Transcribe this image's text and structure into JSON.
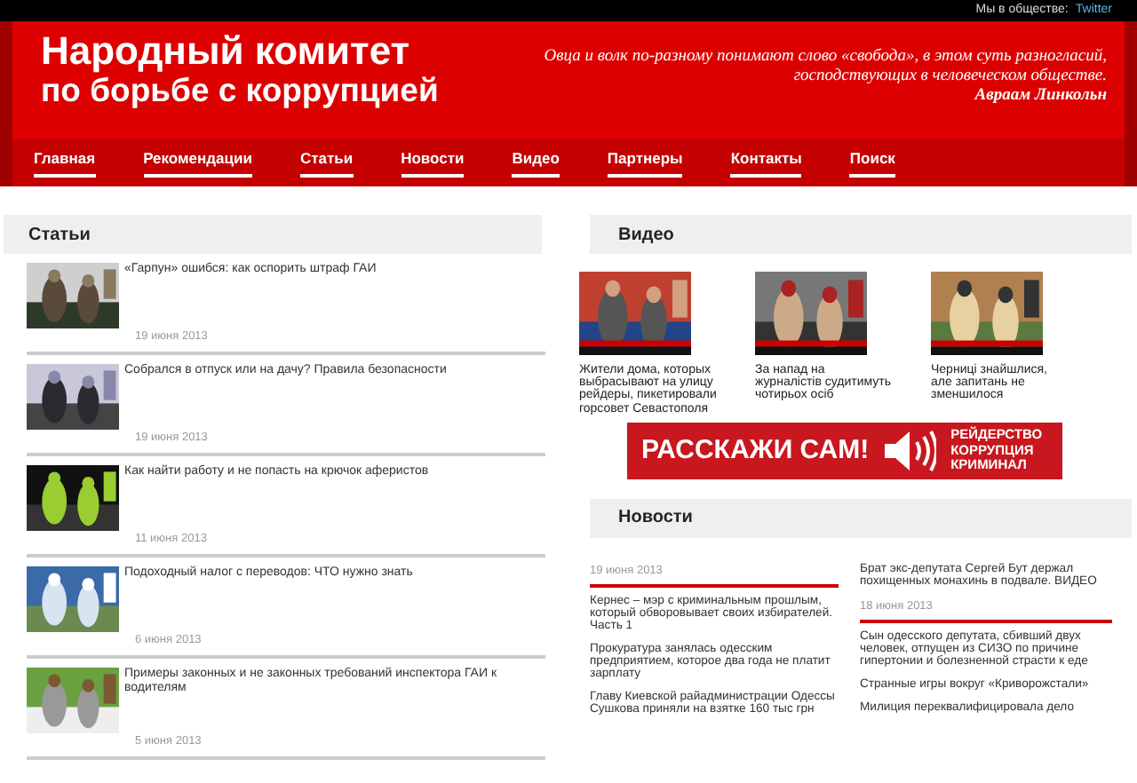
{
  "top_bar": {
    "social_label": "Мы в обществе:",
    "social_link": "Twitter"
  },
  "header": {
    "title_line_1": "Народный комитет",
    "title_line_2": "по борьбе с коррупцией",
    "quote_line_1": "Овца и волк по-разному понимают слово «свобода», в этом суть разногласий,",
    "quote_line_2": "господствующих в человеческом обществе.",
    "quote_author": "Авраам Линкольн"
  },
  "nav": [
    "Главная",
    "Рекомендации",
    "Статьи",
    "Новости",
    "Видео",
    "Партнеры",
    "Контакты",
    "Поиск"
  ],
  "articles": {
    "heading": "Статьи",
    "items": [
      {
        "title": "«Гарпун» ошибся: как оспорить штраф ГАИ",
        "date": "19 июня 2013"
      },
      {
        "title": "Собрался в отпуск или на дачу? Правила безопасности",
        "date": "19 июня 2013"
      },
      {
        "title": "Как найти работу и не попасть на крючок аферистов",
        "date": "11 июня 2013"
      },
      {
        "title": "Подоходный налог с переводов: ЧТО нужно знать",
        "date": "6 июня 2013"
      },
      {
        "title": "Примеры законных и не законных требований инспектора ГАИ к водителям",
        "date": "5 июня 2013"
      }
    ]
  },
  "video": {
    "heading": "Видео",
    "items": [
      {
        "caption": "Жители дома, которых выбрасывают на улицу рейдеры, пикетировали горсовет Севастополя"
      },
      {
        "caption": "За напад на журналістів судитимуть чотирьох осіб"
      },
      {
        "caption": "Черниці знайшлися, але запитань не зменшилося"
      }
    ]
  },
  "banner": {
    "main": "РАССКАЖИ САМ!",
    "lines": [
      "РЕЙДЕРСТВО",
      "КОРРУПЦИЯ",
      "КРИМИНАЛ"
    ]
  },
  "news": {
    "heading": "Новости",
    "columns": [
      [
        {
          "kind": "date",
          "text": "19 июня 2013"
        },
        {
          "kind": "link",
          "text": "Кернес – мэр с криминальным прошлым, который обворовывает своих избирателей. Часть 1"
        },
        {
          "kind": "link",
          "text": "Прокуратура занялась одесским предприятием, которое два года не платит зарплату"
        },
        {
          "kind": "link",
          "text": "Главу Киевской райадминистрации Одессы Сушкова приняли на взятке 160 тыс грн"
        }
      ],
      [
        {
          "kind": "link",
          "text": "Брат экс-депутата Сергей Бут держал похищенных монахинь в подвале. ВИДЕО"
        },
        {
          "kind": "date",
          "text": "18 июня 2013"
        },
        {
          "kind": "link",
          "text": "Сын одесского депутата, сбивший двух человек, отпущен из СИЗО по причине гипертонии и болезненной страсти к еде"
        },
        {
          "kind": "link",
          "text": "Странные игры вокруг «Криворожстали»"
        },
        {
          "kind": "link",
          "text": "Милиция переквалифицировала дело"
        }
      ]
    ]
  }
}
